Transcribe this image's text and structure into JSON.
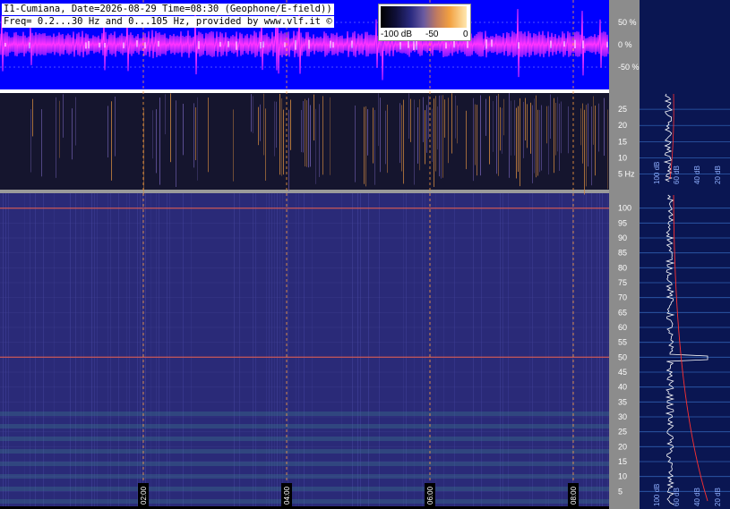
{
  "header": {
    "line1": "I1-Cumiana, Date=2026-08-29 Time=08:30 (Geophone/E-field))",
    "line2": "Freq= 0.2...30 Hz and 0...105 Hz, provided by www.vlf.it ©"
  },
  "colorbar": {
    "labels": [
      "-100 dB",
      "-50",
      "0"
    ]
  },
  "chart_data": [
    {
      "type": "line",
      "panel": "waveform",
      "ylabel_ticks": [
        "50 %",
        "0 %",
        "-50 %"
      ],
      "y_tick_values": [
        50,
        0,
        -50
      ],
      "ylim": [
        -100,
        100
      ],
      "colors": {
        "background": "#0000ff",
        "trace": "#ff33ff",
        "peaks": "#ffffff"
      }
    },
    {
      "type": "heatmap",
      "panel": "spectrogram-low",
      "frequency_range_hz": [
        0.2,
        30
      ],
      "y_ticks": [
        "25",
        "20",
        "15",
        "10",
        "5 Hz"
      ],
      "y_tick_values": [
        25,
        20,
        15,
        10,
        5
      ],
      "ylim": [
        0.2,
        30
      ],
      "side_scale": [
        "100 dB",
        "60 dB",
        "40 dB",
        "20 dB"
      ]
    },
    {
      "type": "heatmap",
      "panel": "spectrogram-high",
      "frequency_range_hz": [
        0,
        105
      ],
      "y_ticks": [
        "100",
        "95",
        "90",
        "85",
        "80",
        "75",
        "70",
        "65",
        "60",
        "55",
        "50",
        "45",
        "40",
        "35",
        "30",
        "25",
        "20",
        "15",
        "10",
        "5"
      ],
      "y_tick_values": [
        100,
        95,
        90,
        85,
        80,
        75,
        70,
        65,
        60,
        55,
        50,
        45,
        40,
        35,
        30,
        25,
        20,
        15,
        10,
        5
      ],
      "ylim": [
        0,
        105
      ],
      "side_scale": [
        "100 dB",
        "60 dB",
        "40 dB",
        "20 dB"
      ],
      "lines_hz": [
        50,
        100
      ]
    }
  ],
  "time_axis": {
    "labels": [
      "02:00",
      "04:00",
      "06:00",
      "08:00"
    ],
    "hours": [
      2,
      4,
      6,
      8
    ],
    "span_hours": [
      0,
      8.5
    ]
  }
}
